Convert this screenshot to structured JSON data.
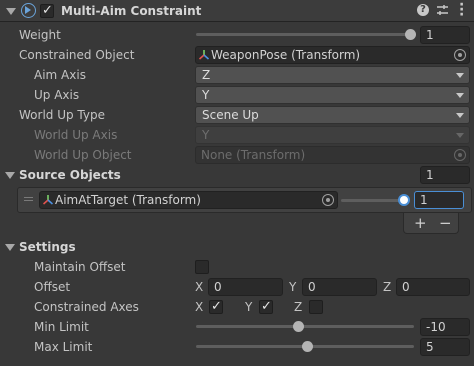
{
  "header": {
    "title": "Multi-Aim Constraint",
    "enabled": true,
    "icons": [
      "constraint-component-icon",
      "help-icon",
      "presets-icon",
      "more-icon"
    ]
  },
  "weight": {
    "label": "Weight",
    "value": "1",
    "slider_fraction": 1.0
  },
  "constrained_object": {
    "label": "Constrained Object",
    "value": "WeaponPose (Transform)"
  },
  "aim_axis": {
    "label": "Aim Axis",
    "value": "Z"
  },
  "up_axis": {
    "label": "Up Axis",
    "value": "Y"
  },
  "world_up_type": {
    "label": "World Up Type",
    "value": "Scene Up"
  },
  "world_up_axis": {
    "label": "World Up Axis",
    "value": "Y"
  },
  "world_up_object": {
    "label": "World Up Object",
    "value": "None (Transform)"
  },
  "source_objects": {
    "label": "Source Objects",
    "count": "1",
    "items": [
      {
        "object": "AimAtTarget (Transform)",
        "weight": "1",
        "slider_fraction": 1.0
      }
    ],
    "add_label": "+",
    "remove_label": "−"
  },
  "settings": {
    "label": "Settings",
    "maintain_offset": {
      "label": "Maintain Offset",
      "checked": false
    },
    "offset": {
      "label": "Offset",
      "x_label": "X",
      "x": "0",
      "y_label": "Y",
      "y": "0",
      "z_label": "Z",
      "z": "0"
    },
    "constrained_axes": {
      "label": "Constrained Axes",
      "x_label": "X",
      "x": true,
      "y_label": "Y",
      "y": true,
      "z_label": "Z",
      "z": false
    },
    "min_limit": {
      "label": "Min Limit",
      "value": "-10",
      "slider_fraction": 0.47
    },
    "max_limit": {
      "label": "Max Limit",
      "value": "5",
      "slider_fraction": 0.52
    }
  },
  "colors": {
    "accent": "#4a8fd6",
    "background": "#383838"
  }
}
